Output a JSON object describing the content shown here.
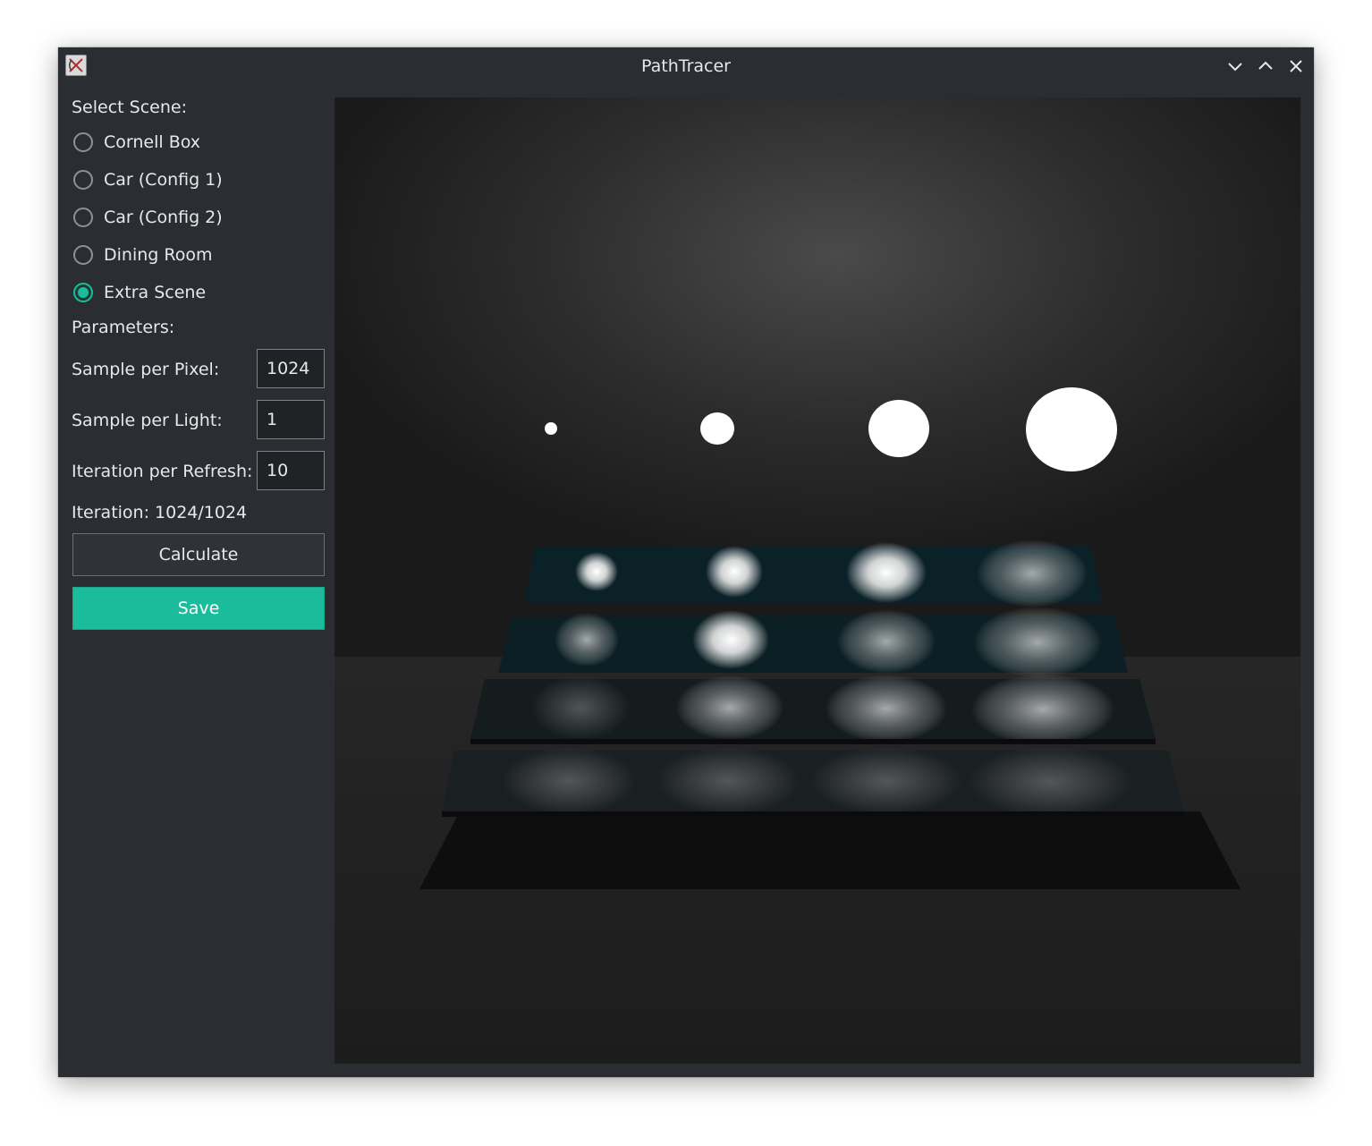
{
  "window": {
    "title": "PathTracer",
    "controls": [
      "minimize",
      "maximize",
      "close"
    ]
  },
  "sidebar": {
    "scene_heading": "Select Scene:",
    "scenes": [
      {
        "label": "Cornell Box",
        "checked": false
      },
      {
        "label": "Car (Config 1)",
        "checked": false
      },
      {
        "label": "Car (Config 2)",
        "checked": false
      },
      {
        "label": "Dining Room",
        "checked": false
      },
      {
        "label": "Extra Scene",
        "checked": true
      }
    ],
    "params_heading": "Parameters:",
    "params": [
      {
        "label": "Sample per Pixel:",
        "value": "1024"
      },
      {
        "label": "Sample per Light:",
        "value": "1"
      },
      {
        "label": "Iteration per Refresh:",
        "value": "10"
      }
    ],
    "iteration_status": "Iteration: 1024/1024",
    "calculate_label": "Calculate",
    "save_label": "Save"
  },
  "render": {
    "scene": "Extra Scene",
    "light_count": 4,
    "plate_count": 4
  },
  "colors": {
    "accent": "#1abc9c",
    "window_bg": "#2a2e32",
    "text": "#e6e8ea"
  }
}
